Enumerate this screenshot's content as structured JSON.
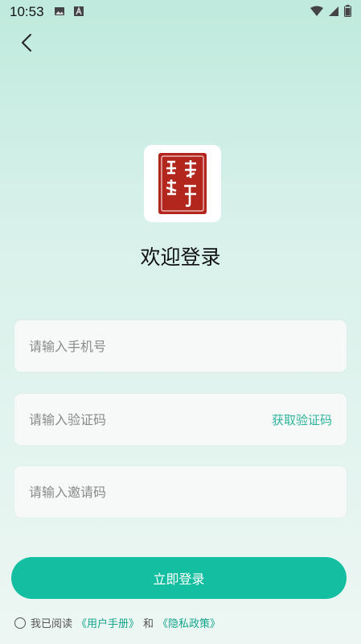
{
  "status_bar": {
    "time": "10:53",
    "left_icons": [
      "image-icon",
      "text-a-icon"
    ],
    "right_icons": [
      "wifi-icon",
      "signal-icon",
      "battery-icon"
    ]
  },
  "nav": {
    "back_icon": "chevron-left-icon"
  },
  "logo": {
    "alt": "漢草鋪子",
    "accent": "#b3261e"
  },
  "title": "欢迎登录",
  "form": {
    "phone_placeholder": "请输入手机号",
    "code_placeholder": "请输入验证码",
    "get_code_label": "获取验证码",
    "invite_placeholder": "请输入邀请码"
  },
  "login_label": "立即登录",
  "agreement": {
    "prefix": "我已阅读",
    "user_manual": "《用户手册》",
    "and": "和",
    "privacy": "《隐私政策》"
  },
  "colors": {
    "accent": "#13bfa0",
    "link": "#13a58c",
    "background_top": "#bfeadd",
    "background_bottom": "#edf6f3"
  }
}
